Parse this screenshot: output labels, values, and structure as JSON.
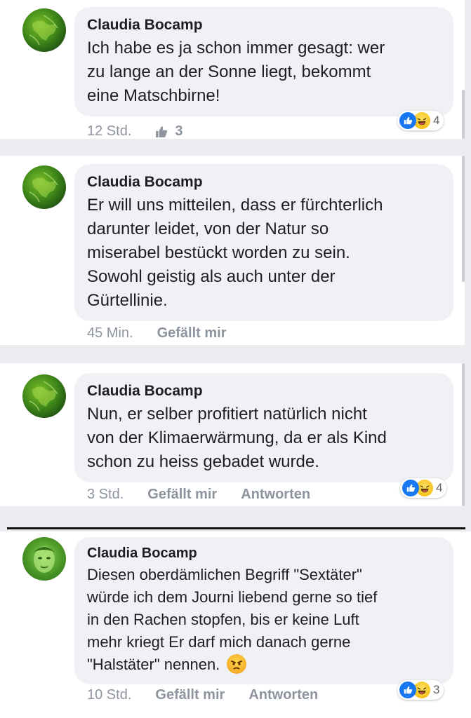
{
  "comments": [
    {
      "author": "Claudia Bocamp",
      "lines": [
        "Ich habe es ja schon immer gesagt: wer",
        "zu lange an der Sonne liegt, bekommt",
        "eine Matschbirne!"
      ],
      "time": "12 Std.",
      "likes": "3",
      "reaction_count": "4"
    },
    {
      "author": "Claudia Bocamp",
      "lines": [
        "Er will uns mitteilen, dass er fürchterlich",
        "darunter leidet, von der Natur so",
        "miserabel bestückt worden zu sein.",
        "Sowohl geistig als auch unter der",
        "Gürtellinie."
      ],
      "time": "45 Min.",
      "like_label": "Gefällt mir"
    },
    {
      "author": "Claudia Bocamp",
      "lines": [
        "Nun, er selber profitiert natürlich nicht",
        "von der Klimaerwärmung, da er als Kind",
        "schon zu heiss gebadet wurde."
      ],
      "time": "3 Std.",
      "like_label": "Gefällt mir",
      "reply_label": "Antworten",
      "reaction_count": "4"
    },
    {
      "author": "Claudia Bocamp",
      "lines": [
        "Diesen oberdämlichen Begriff \"Sextäter\"",
        "würde ich dem Journi liebend gerne so tief",
        "in den Rachen stopfen, bis er keine Luft",
        "mehr kriegt Er darf mich danach gerne",
        "\"Halstäter\" nennen."
      ],
      "inline_emoji": "angry-face",
      "time": "10 Std.",
      "like_label": "Gefällt mir",
      "reply_label": "Antworten",
      "reaction_count": "3"
    }
  ],
  "colors": {
    "like_blue": "#1877f2",
    "bubble": "#f0f1f4",
    "meta_gray": "#8d949e"
  }
}
